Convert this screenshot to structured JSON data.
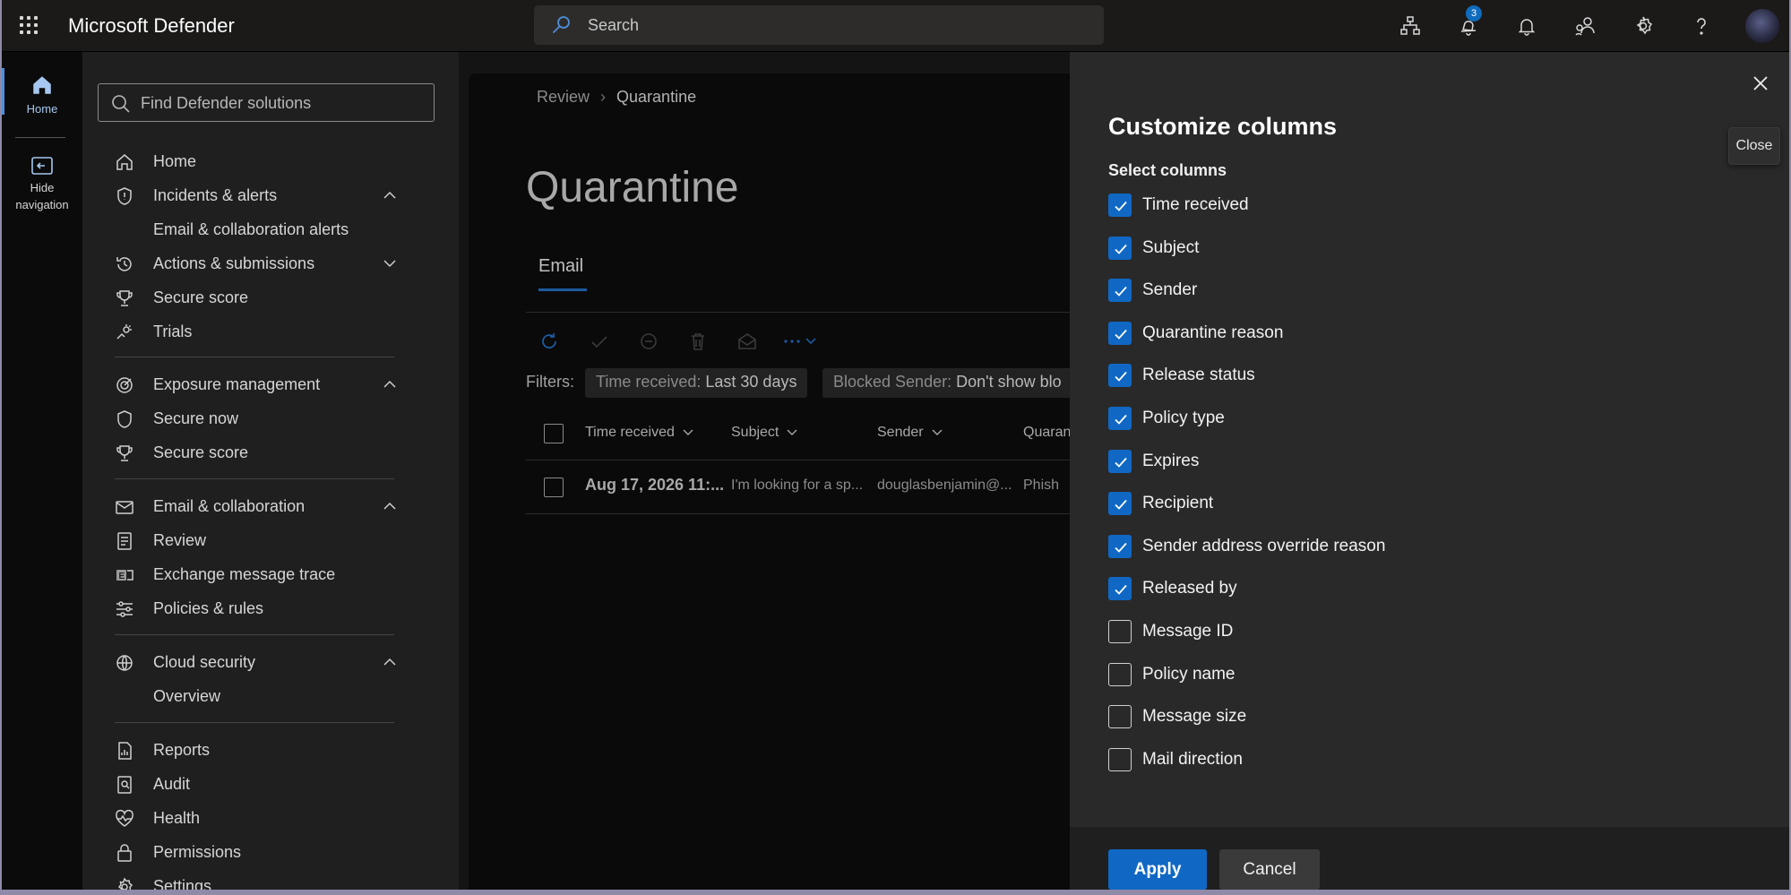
{
  "app": {
    "title": "Microsoft Defender"
  },
  "topbar": {
    "search_placeholder": "Search",
    "icons": [
      "org-chart-icon",
      "notifications-icon",
      "bell-icon",
      "community-icon",
      "gear-icon",
      "help-icon",
      "avatar"
    ],
    "notification_count": "3"
  },
  "rail": {
    "home_label": "Home",
    "hide_nav_label_1": "Hide",
    "hide_nav_label_2": "navigation"
  },
  "nav": {
    "search_placeholder": "Find Defender solutions",
    "items": [
      {
        "label": "Home",
        "icon": "home-icon"
      },
      {
        "label": "Incidents & alerts",
        "icon": "shield-icon",
        "chevron": "up"
      },
      {
        "label": "Email & collaboration alerts"
      },
      {
        "label": "Actions & submissions",
        "icon": "history-icon",
        "chevron": "down"
      },
      {
        "label": "Secure score",
        "icon": "trophy-icon"
      },
      {
        "label": "Trials",
        "icon": "trials-icon"
      },
      {
        "label": "Exposure management",
        "icon": "target-icon",
        "chevron": "up"
      },
      {
        "label": "Secure now",
        "icon": "shield-icon"
      },
      {
        "label": "Secure score",
        "icon": "trophy-icon"
      },
      {
        "label": "Email & collaboration",
        "icon": "mail-icon",
        "chevron": "up"
      },
      {
        "label": "Review",
        "icon": "document-icon"
      },
      {
        "label": "Exchange message trace",
        "icon": "exchange-icon"
      },
      {
        "label": "Policies & rules",
        "icon": "sliders-icon"
      },
      {
        "label": "Cloud security",
        "icon": "globe-icon",
        "chevron": "up"
      },
      {
        "label": "Overview"
      },
      {
        "label": "Reports",
        "icon": "report-icon"
      },
      {
        "label": "Audit",
        "icon": "audit-icon"
      },
      {
        "label": "Health",
        "icon": "heart-pulse-icon"
      },
      {
        "label": "Permissions",
        "icon": "lock-icon"
      },
      {
        "label": "Settings",
        "icon": "gear-icon"
      }
    ]
  },
  "main": {
    "breadcrumb": [
      "Review",
      "Quarantine"
    ],
    "page_title": "Quarantine",
    "tab": "Email",
    "filters_label": "Filters:",
    "filters": [
      {
        "name": "Time received:",
        "value": "Last 30 days"
      },
      {
        "name": "Blocked Sender:",
        "value": "Don't show blo"
      }
    ],
    "columns": [
      "Time received",
      "Subject",
      "Sender",
      "Quaran"
    ],
    "rows": [
      {
        "time": "Aug 17, 2026 11:...",
        "subject": "I'm looking for a sp...",
        "sender": "douglasbenjamin@...",
        "reason": "Phish"
      }
    ]
  },
  "panel": {
    "title": "Customize columns",
    "select_label": "Select columns",
    "close_tooltip": "Close",
    "options": [
      {
        "label": "Time received",
        "checked": true
      },
      {
        "label": "Subject",
        "checked": true
      },
      {
        "label": "Sender",
        "checked": true
      },
      {
        "label": "Quarantine reason",
        "checked": true
      },
      {
        "label": "Release status",
        "checked": true
      },
      {
        "label": "Policy type",
        "checked": true
      },
      {
        "label": "Expires",
        "checked": true
      },
      {
        "label": "Recipient",
        "checked": true
      },
      {
        "label": "Sender address override reason",
        "checked": true
      },
      {
        "label": "Released by",
        "checked": true
      },
      {
        "label": "Message ID",
        "checked": false
      },
      {
        "label": "Policy name",
        "checked": false
      },
      {
        "label": "Message size",
        "checked": false
      },
      {
        "label": "Mail direction",
        "checked": false
      }
    ],
    "apply_label": "Apply",
    "cancel_label": "Cancel"
  },
  "colors": {
    "accent": "#1068c4",
    "panel_bg": "#292929",
    "nav_bg": "#1f1f1f",
    "topbar_bg": "#1b1a19"
  }
}
